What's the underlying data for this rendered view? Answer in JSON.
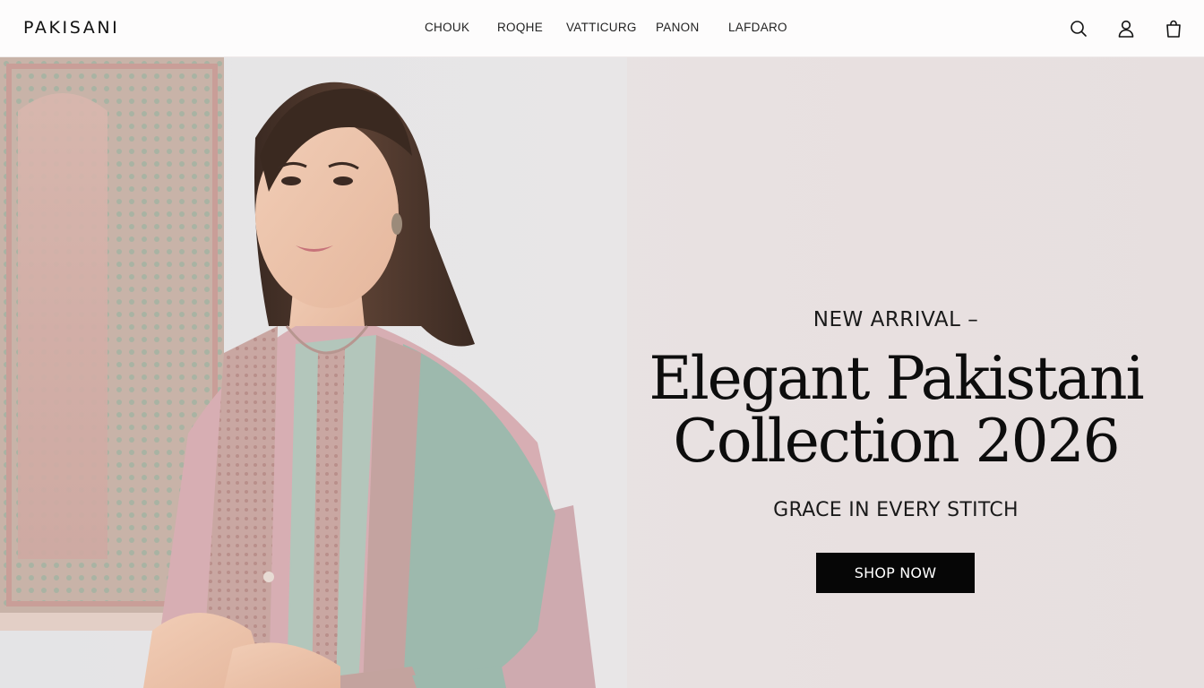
{
  "brand": {
    "logo": "PAKISANI"
  },
  "nav": {
    "items": [
      {
        "label": "CHOUK"
      },
      {
        "label": "ROQHE"
      },
      {
        "label": "VATTICURG"
      },
      {
        "label": "PANON"
      },
      {
        "label": "LAFDARO"
      }
    ]
  },
  "header_icons": [
    "search-icon",
    "account-icon",
    "shopping-bag-icon"
  ],
  "hero": {
    "eyebrow": "NEW ARRIVAL –",
    "title_line1": "Elegant Pakistani",
    "title_line2": "Collection 2026",
    "subtitle": "GRACE IN EVERY STITCH",
    "cta_label": "SHOP NOW"
  },
  "colors": {
    "header_bg": "#fdfcfc",
    "hero_bg": "#e8e2e2",
    "cta_bg": "#060606",
    "cta_text": "#ffffff",
    "garment_pink": "#d7aeb3",
    "garment_mint": "#9db9ad"
  }
}
